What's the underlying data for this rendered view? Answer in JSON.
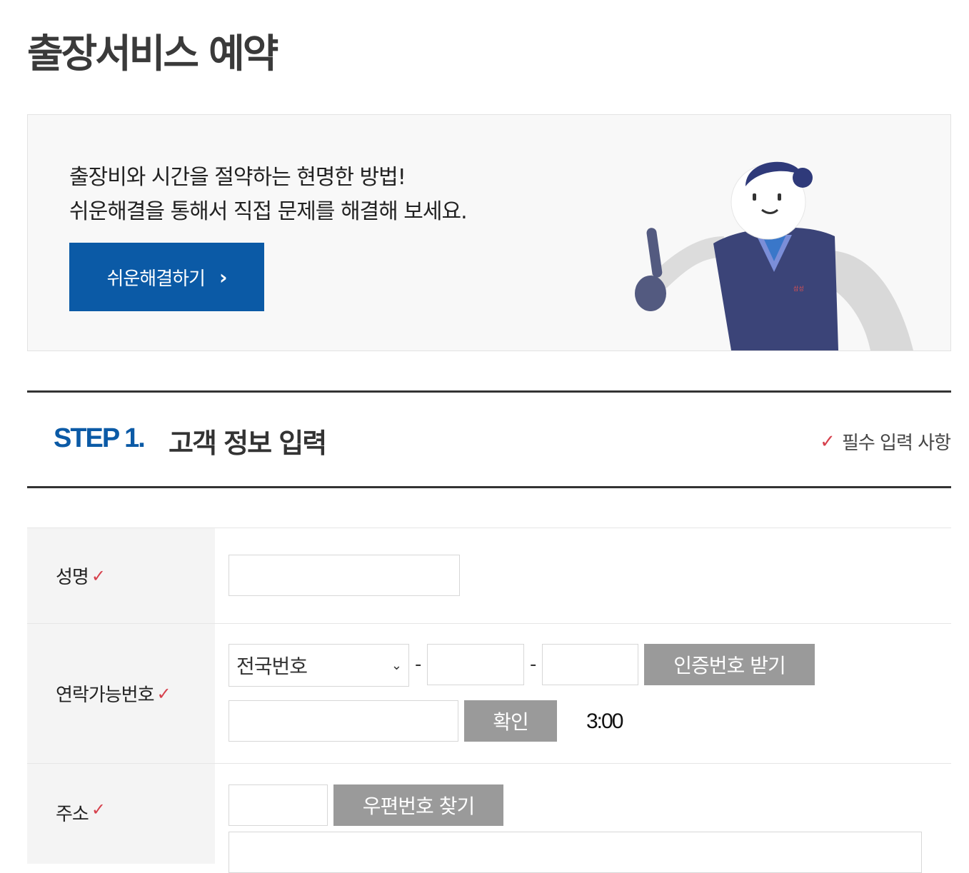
{
  "page": {
    "title": "출장서비스 예약"
  },
  "banner": {
    "line1": "출장비와 시간을 절약하는 현명한 방법!",
    "line2": "쉬운해결을 통해서 직접 문제를 해결해 보세요.",
    "button_label": "쉬운해결하기",
    "button_icon": "chevron-right-icon",
    "mascot_badge": "삼성"
  },
  "step": {
    "number": "STEP 1.",
    "title": "고객 정보 입력",
    "required_note": "필수 입력 사항"
  },
  "form": {
    "name": {
      "label": "성명",
      "value": ""
    },
    "phone": {
      "label": "연락가능번호",
      "area_select": "전국번호",
      "dash": "-",
      "request_code_button": "인증번호 받기",
      "confirm_button": "확인",
      "timer": "3:00"
    },
    "address": {
      "label": "주소",
      "zip_button": "우편번호 찾기"
    }
  },
  "colors": {
    "accent": "#0b5aa6",
    "check": "#d6404c",
    "gray_button": "#9a9a9a"
  }
}
